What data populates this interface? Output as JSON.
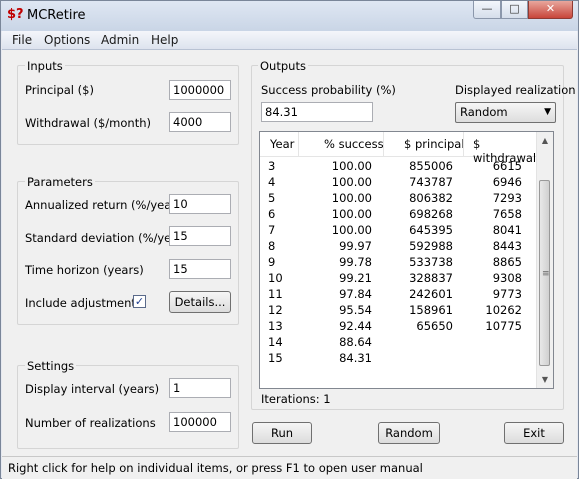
{
  "window": {
    "icon_text": "$?",
    "title": "MCRetire",
    "min_glyph": "—",
    "max_glyph": "□",
    "close_glyph": "✕"
  },
  "menu": [
    "File",
    "Options",
    "Admin",
    "Help"
  ],
  "inputs": {
    "title": "Inputs",
    "principal_label": "Principal ($)",
    "principal_value": "1000000",
    "withdrawal_label": "Withdrawal ($/month)",
    "withdrawal_value": "4000"
  },
  "parameters": {
    "title": "Parameters",
    "return_label": "Annualized return (%/year)",
    "return_value": "10",
    "stddev_label": "Standard deviation (%/year)",
    "stddev_value": "15",
    "horizon_label": "Time horizon (years)",
    "horizon_value": "15",
    "adjustments_label": "Include adjustments",
    "adjustments_checked": true,
    "details_label": "Details..."
  },
  "settings": {
    "title": "Settings",
    "interval_label": "Display interval (years)",
    "interval_value": "1",
    "realizations_label": "Number of realizations",
    "realizations_value": "100000"
  },
  "outputs": {
    "title": "Outputs",
    "success_label": "Success probability (%)",
    "success_value": "84.31",
    "realization_label": "Displayed realization",
    "realization_selected": "Random",
    "table": {
      "headers": [
        "Year",
        "% success",
        "$ principal",
        "$ withdrawal"
      ],
      "rows": [
        [
          "3",
          "100.00",
          "855006",
          "6615"
        ],
        [
          "4",
          "100.00",
          "743787",
          "6946"
        ],
        [
          "5",
          "100.00",
          "806382",
          "7293"
        ],
        [
          "6",
          "100.00",
          "698268",
          "7658"
        ],
        [
          "7",
          "100.00",
          "645395",
          "8041"
        ],
        [
          "8",
          "99.97",
          "592988",
          "8443"
        ],
        [
          "9",
          "99.78",
          "533738",
          "8865"
        ],
        [
          "10",
          "99.21",
          "328837",
          "9308"
        ],
        [
          "11",
          "97.84",
          "242601",
          "9773"
        ],
        [
          "12",
          "95.54",
          "158961",
          "10262"
        ],
        [
          "13",
          "92.44",
          "65650",
          "10775"
        ],
        [
          "14",
          "88.64",
          "",
          ""
        ],
        [
          "15",
          "84.31",
          "",
          ""
        ]
      ]
    },
    "iterations_text": "Iterations: 1"
  },
  "buttons": {
    "run": "Run",
    "random": "Random",
    "exit": "Exit"
  },
  "status": "Right click for help on individual items, or press F1 to open user manual"
}
